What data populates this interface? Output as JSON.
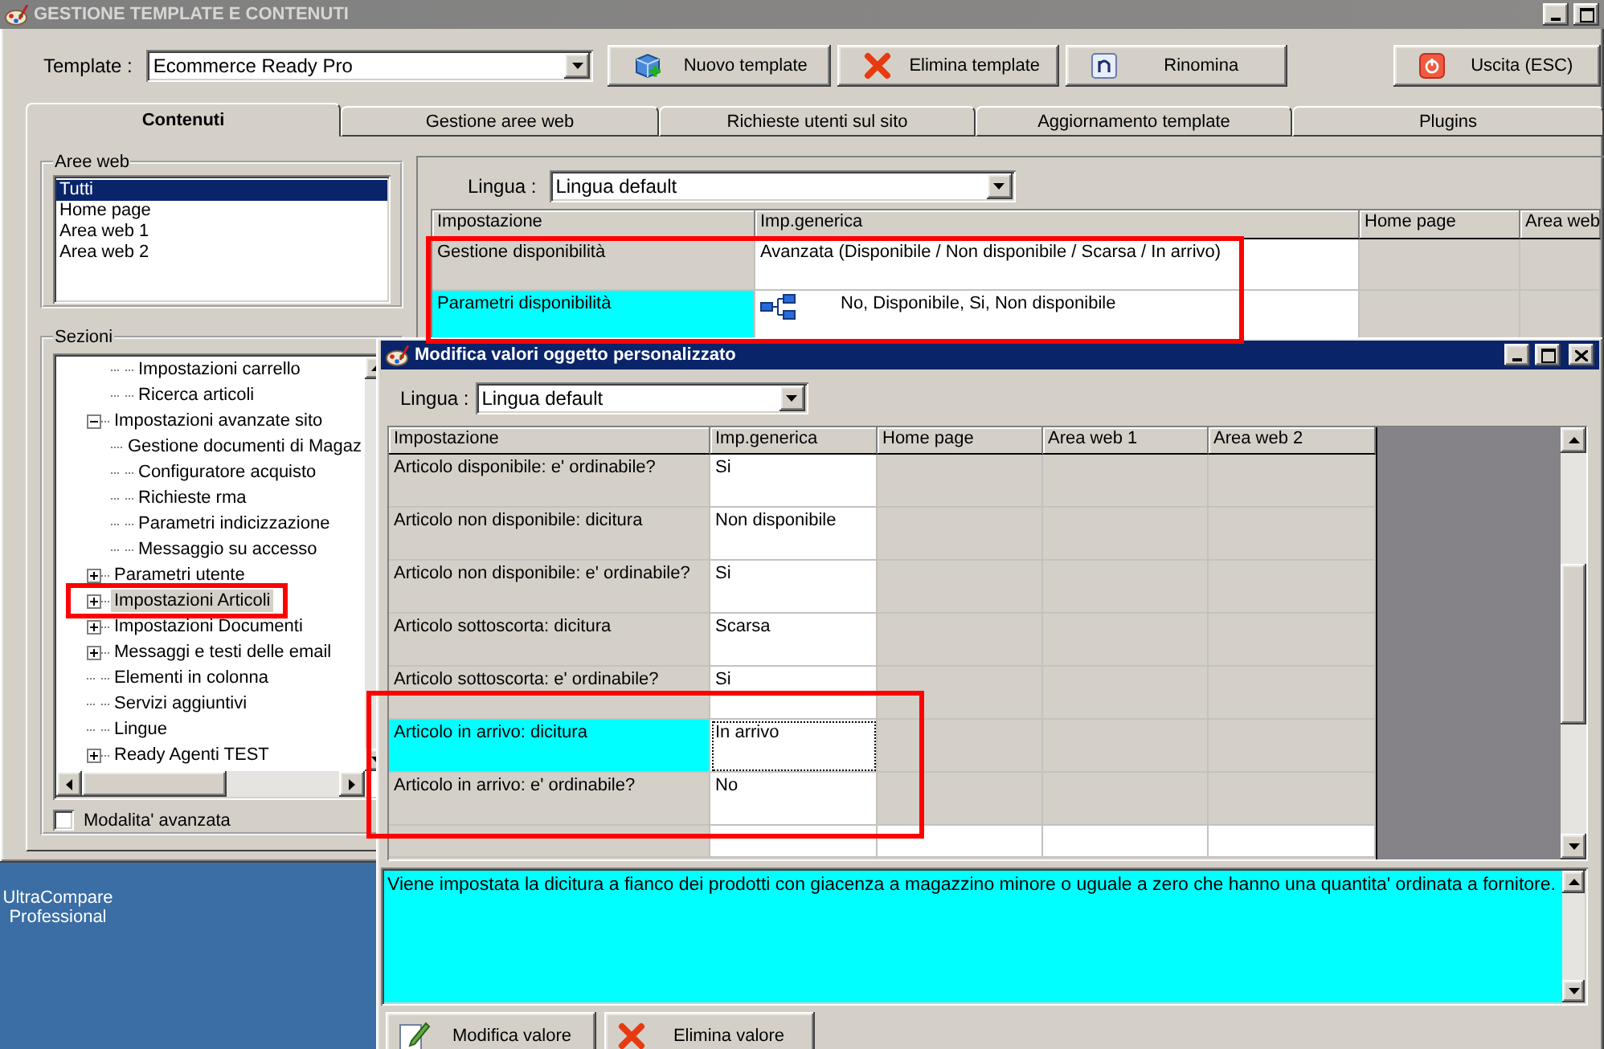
{
  "window": {
    "title": "GESTIONE TEMPLATE E CONTENUTI"
  },
  "toolbar": {
    "template_label": "Template :",
    "template_value": "Ecommerce Ready Pro",
    "buttons": [
      {
        "label": "Nuovo template",
        "kind": "new"
      },
      {
        "label": "Elimina template",
        "kind": "delete"
      },
      {
        "label": "Rinomina",
        "kind": "rename"
      },
      {
        "label": "Uscita (ESC)",
        "kind": "exit"
      }
    ]
  },
  "tabs": [
    {
      "label": "Contenuti",
      "selected": true
    },
    {
      "label": "Gestione aree web",
      "selected": false
    },
    {
      "label": "Richieste utenti sul sito",
      "selected": false
    },
    {
      "label": "Aggiornamento template",
      "selected": false
    },
    {
      "label": "Plugins",
      "selected": false
    }
  ],
  "web_areas": {
    "title": "Aree web",
    "items": [
      {
        "label": "Tutti",
        "selected": true
      },
      {
        "label": "Home page",
        "selected": false
      },
      {
        "label": "Area web 1",
        "selected": false
      },
      {
        "label": "Area web 2",
        "selected": false
      }
    ]
  },
  "sections": {
    "title": "Sezioni",
    "tree": [
      {
        "children": [
          {
            "label": "Impostazioni carrello",
            "selected": false
          },
          {
            "label": "Ricerca articoli",
            "selected": false
          }
        ]
      },
      {
        "label": "Impostazioni avanzate sito",
        "selected": false,
        "expanded": true,
        "children": [
          {
            "label": "Gestione documenti di Magaz",
            "selected": false
          },
          {
            "label": "Configuratore acquisto",
            "selected": false
          },
          {
            "label": "Richieste rma",
            "selected": false
          },
          {
            "label": "Parametri indicizzazione",
            "selected": false
          },
          {
            "label": "Messaggio su accesso",
            "selected": false
          }
        ]
      },
      {
        "label": "Parametri utente",
        "selected": false,
        "expanded": false
      },
      {
        "label": "Impostazioni Articoli",
        "selected": true,
        "expanded": false,
        "annotated": true
      },
      {
        "label": "Impostazioni Documenti",
        "selected": false,
        "expanded": false
      },
      {
        "label": "Messaggi e testi delle email",
        "selected": false,
        "expanded": false
      },
      {
        "label": "Elementi in colonna",
        "selected": false
      },
      {
        "label": "Servizi aggiuntivi",
        "selected": false
      },
      {
        "label": "Lingue",
        "selected": false
      },
      {
        "label": "Ready Agenti TEST",
        "selected": false,
        "expanded": false
      }
    ],
    "advanced_mode": {
      "label": "Modalita' avanzata",
      "checked": false
    }
  },
  "settings": {
    "language_label": "Lingua :",
    "language": "Lingua default",
    "annotated": true,
    "columns": [
      "Impostazione",
      "Imp.generica",
      "Home page",
      "Area web"
    ],
    "rows": [
      {
        "setting": "Gestione disponibilità",
        "value": "Avanzata (Disponibile / Non disponibile / Scarsa / In arrivo)",
        "kind": "text",
        "selected": false
      },
      {
        "setting": "Parametri disponibilità",
        "value": "No, Disponibile, Si, Non disponibile",
        "kind": "hierarchy",
        "selected": true
      }
    ]
  },
  "desktop": {
    "icon_label": "UltraCompare Professional"
  },
  "dialog": {
    "title": "Modifica valori oggetto personalizzato",
    "language_label": "Lingua :",
    "language": "Lingua default",
    "annotated": true,
    "columns": [
      "Impostazione",
      "Imp.generica",
      "Home page",
      "Area web 1",
      "Area web 2"
    ],
    "rows": [
      {
        "setting": "Articolo disponibile: e' ordinabile?",
        "value": "Si",
        "selected": false
      },
      {
        "setting": "Articolo non disponibile: dicitura",
        "value": "Non disponibile",
        "selected": false
      },
      {
        "setting": "Articolo non disponibile: e' ordinabile?",
        "value": "Si",
        "selected": false
      },
      {
        "setting": "Articolo sottoscorta: dicitura",
        "value": "Scarsa",
        "selected": false
      },
      {
        "setting": "Articolo sottoscorta: e' ordinabile?",
        "value": "Si",
        "selected": false
      },
      {
        "setting": "Articolo in arrivo: dicitura",
        "value": "In arrivo",
        "selected": true
      },
      {
        "setting": "Articolo in arrivo: e' ordinabile?",
        "value": "No",
        "selected": false
      }
    ],
    "description": "Viene impostata la dicitura a fianco dei prodotti con giacenza a magazzino minore o uguale a zero che hanno una quantita' ordinata a fornitore.",
    "buttons": [
      {
        "label": "Modifica valore",
        "kind": "edit"
      },
      {
        "label": "Elimina valore",
        "kind": "delete"
      }
    ]
  }
}
